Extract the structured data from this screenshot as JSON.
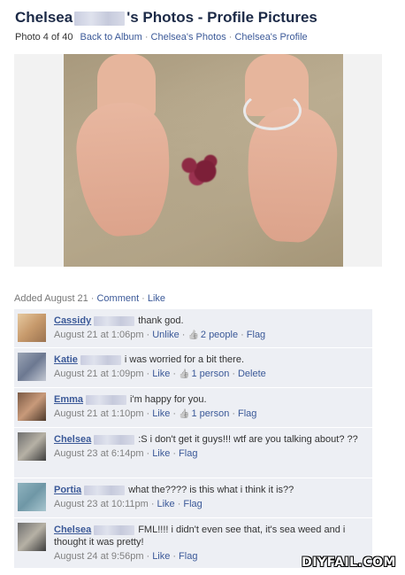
{
  "header": {
    "name_first": "Chelsea",
    "title_suffix": "'s Photos - Profile Pictures"
  },
  "subnav": {
    "count": "Photo 4 of 40",
    "back_to_album": "Back to Album",
    "photos_link": "Chelsea's Photos",
    "profile_link": "Chelsea's Profile",
    "separator": "·"
  },
  "photo_meta": {
    "added": "Added August 21",
    "comment_link": "Comment",
    "like_link": "Like"
  },
  "comments": [
    {
      "author": "Cassidy",
      "text": "thank god.",
      "time": "August 21 at 1:06pm",
      "actions": [
        "Unlike"
      ],
      "likes": "2 people",
      "trailing": [
        "Flag"
      ],
      "avatar_colors": [
        "#e6c9a0",
        "#c79a6c",
        "#9b7350"
      ]
    },
    {
      "author": "Katie",
      "text": "i was worried for a bit there.",
      "time": "August 21 at 1:09pm",
      "actions": [
        "Like"
      ],
      "likes": "1 person",
      "trailing": [
        "Delete"
      ],
      "avatar_colors": [
        "#9aa4b4",
        "#6c7891",
        "#c3c8d3"
      ]
    },
    {
      "author": "Emma",
      "text": "i'm happy for you.",
      "time": "August 21 at 1:10pm",
      "actions": [
        "Like"
      ],
      "likes": "1 person",
      "trailing": [
        "Flag"
      ],
      "avatar_colors": [
        "#7b5a45",
        "#c89a7a",
        "#4e3a2c"
      ]
    },
    {
      "author": "Chelsea",
      "text": ":S i don't get it guys!!! wtf are you talking about? ??",
      "time": "August 23 at 6:14pm",
      "actions": [
        "Like"
      ],
      "likes": "",
      "trailing": [
        "Flag"
      ],
      "avatar_colors": [
        "#6f6f6f",
        "#b6b1a5",
        "#3d3d3d"
      ]
    },
    {
      "author": "Portia",
      "text": "what the???? is this what i think it is??",
      "time": "August 23 at 10:11pm",
      "actions": [
        "Like"
      ],
      "likes": "",
      "trailing": [
        "Flag"
      ],
      "avatar_colors": [
        "#8fb3bf",
        "#6f97a6",
        "#a8c6cf"
      ]
    },
    {
      "author": "Chelsea",
      "text": "FML!!!! i didn't even see that, it's sea weed and i thought it was pretty!",
      "time": "August 24 at 9:56pm",
      "actions": [
        "Like"
      ],
      "likes": "",
      "trailing": [
        "Flag"
      ],
      "avatar_colors": [
        "#6f6f6f",
        "#b6b1a5",
        "#3d3d3d"
      ]
    }
  ],
  "watermark": "DIYFAIL.COM",
  "icons": {
    "like": "thumbs-up-icon"
  },
  "colors": {
    "link": "#3b5998",
    "comment_bg": "#edeff4",
    "title": "#1c2a47"
  }
}
